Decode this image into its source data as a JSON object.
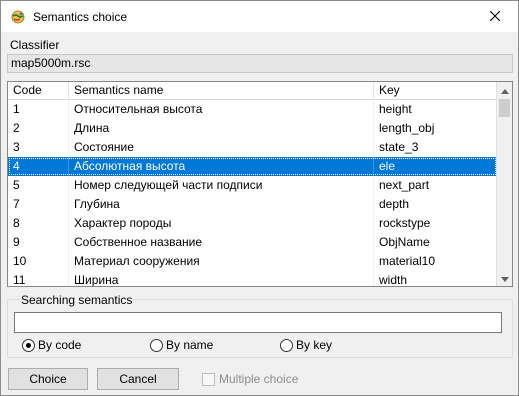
{
  "window": {
    "title": "Semantics choice",
    "icon": "app-globe-icon",
    "close_icon": "close-icon"
  },
  "classifier": {
    "label": "Classifier",
    "value": "map5000m.rsc"
  },
  "table": {
    "headers": {
      "code": "Code",
      "name": "Semantics name",
      "key": "Key"
    },
    "rows": [
      {
        "code": "1",
        "name": "Относительная высота",
        "key": "height"
      },
      {
        "code": "2",
        "name": "Длина",
        "key": "length_obj"
      },
      {
        "code": "3",
        "name": "Состояние",
        "key": "state_3"
      },
      {
        "code": "4",
        "name": "Абсолютная высота",
        "key": "ele"
      },
      {
        "code": "5",
        "name": "Номер следующей части подписи",
        "key": "next_part"
      },
      {
        "code": "7",
        "name": "Глубина",
        "key": "depth"
      },
      {
        "code": "8",
        "name": "Характер породы",
        "key": "rockstype"
      },
      {
        "code": "9",
        "name": "Собственное название",
        "key": "ObjName"
      },
      {
        "code": "10",
        "name": "Материал сооружения",
        "key": "material10"
      },
      {
        "code": "11",
        "name": "Ширина",
        "key": "width"
      }
    ],
    "selected_row_index": 3,
    "selection_color": "#0078d7"
  },
  "search": {
    "group_label": "Searching semantics",
    "value": "",
    "options": [
      {
        "label": "By code",
        "checked": true
      },
      {
        "label": "By name",
        "checked": false
      },
      {
        "label": "By key",
        "checked": false
      }
    ]
  },
  "footer": {
    "choice_label": "Choice",
    "cancel_label": "Cancel",
    "multiple_choice_label": "Multiple choice",
    "multiple_choice_enabled": false,
    "multiple_choice_checked": false
  }
}
